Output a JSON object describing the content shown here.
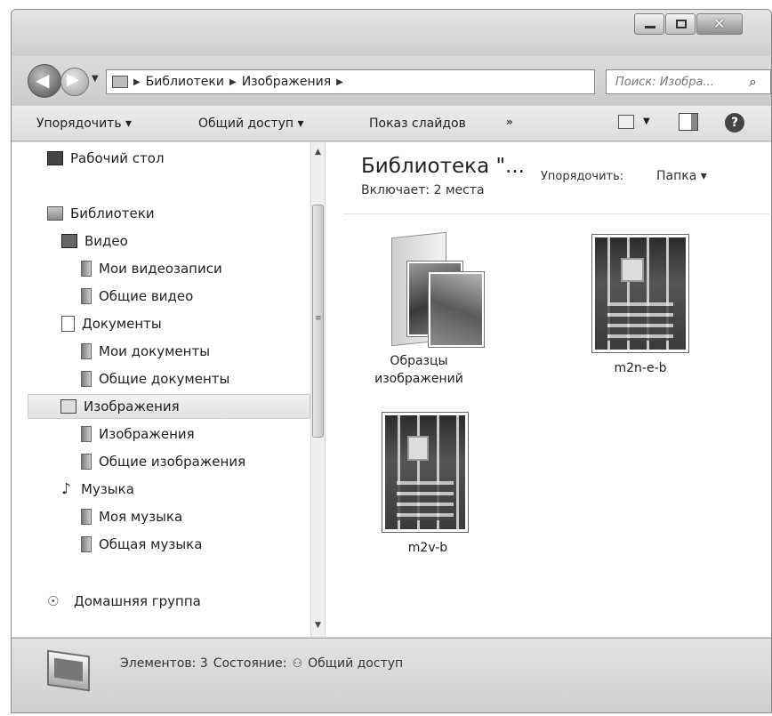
{
  "window": {
    "controls": {
      "minimize": "minimize",
      "maximize": "maximize",
      "close": "✕"
    }
  },
  "address_bar": {
    "breadcrumbs": [
      "Библиотеки",
      "Изображения"
    ],
    "search_placeholder": "Поиск: Изобра..."
  },
  "toolbar": {
    "organize": "Упорядочить ▾",
    "share": "Общий доступ ▾",
    "slideshow": "Показ слайдов",
    "more": "»"
  },
  "nav_pane": {
    "items": [
      {
        "label": "Рабочий стол",
        "icon": "desktop-icon"
      },
      {
        "label": "Библиотеки",
        "icon": "library-icon"
      },
      {
        "label": "Видео",
        "icon": "video-icon"
      },
      {
        "label": "Мои видеозаписи",
        "icon": "folder-icon"
      },
      {
        "label": "Общие видео",
        "icon": "folder-icon"
      },
      {
        "label": "Документы",
        "icon": "document-icon"
      },
      {
        "label": "Мои документы",
        "icon": "folder-icon"
      },
      {
        "label": "Общие документы",
        "icon": "folder-icon"
      },
      {
        "label": "Изображения",
        "icon": "pictures-icon",
        "selected": true
      },
      {
        "label": "Изображения",
        "icon": "folder-icon"
      },
      {
        "label": "Общие изображения",
        "icon": "folder-icon"
      },
      {
        "label": "Музыка",
        "icon": "music-icon"
      },
      {
        "label": "Моя музыка",
        "icon": "folder-icon"
      },
      {
        "label": "Общая музыка",
        "icon": "folder-icon"
      },
      {
        "label": "Домашняя группа",
        "icon": "homegroup-icon"
      }
    ]
  },
  "content": {
    "title": "Библиотека \"...",
    "includes": "Включает: 2 места",
    "arrange_label": "Упорядочить:",
    "arrange_value": "Папка ▾",
    "items": [
      {
        "label_line1": "Образцы",
        "label_line2": "изображений",
        "kind": "folder"
      },
      {
        "label": "m2n-e-b",
        "kind": "image"
      },
      {
        "label": "m2v-b",
        "kind": "image"
      }
    ]
  },
  "status_bar": {
    "items_count": "Элементов: 3",
    "state_label": "Состояние:",
    "state_value": "Общий доступ"
  },
  "colors": {
    "selection": "#e8e8e8",
    "frame": "#d6d6d6"
  }
}
